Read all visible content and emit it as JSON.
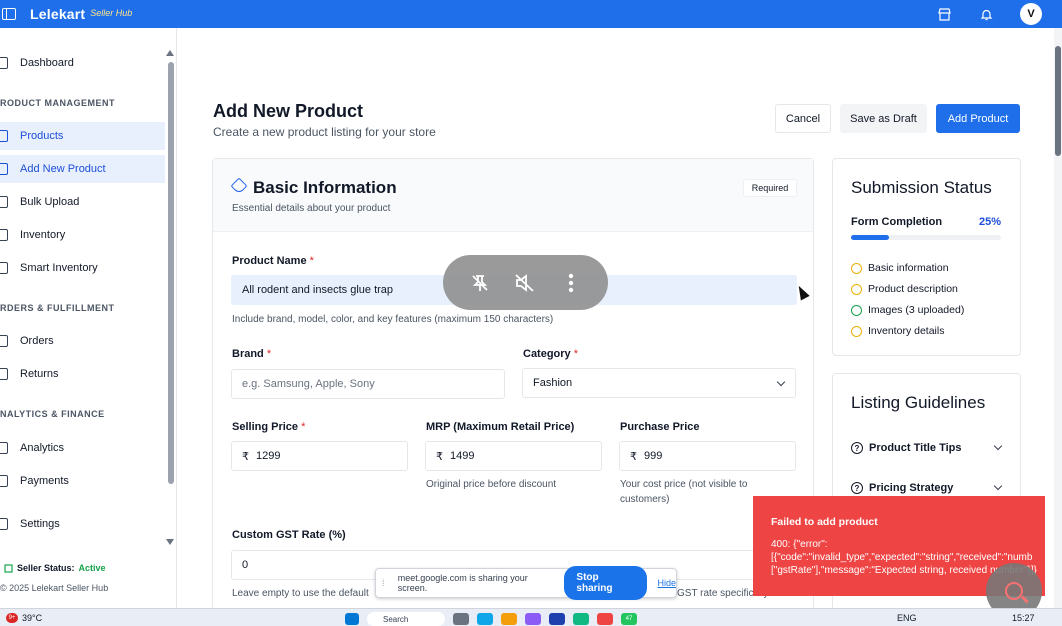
{
  "app": {
    "brand": "Lelekart",
    "brand_sub": "Seller Hub",
    "avatar_initial": "V"
  },
  "sidebar": {
    "items": [
      {
        "label": "Dashboard"
      },
      {
        "label": "Products"
      },
      {
        "label": "Add New Product"
      },
      {
        "label": "Bulk Upload"
      },
      {
        "label": "Inventory"
      },
      {
        "label": "Smart Inventory"
      },
      {
        "label": "Orders"
      },
      {
        "label": "Returns"
      },
      {
        "label": "Analytics"
      },
      {
        "label": "Payments"
      },
      {
        "label": "Settings"
      }
    ],
    "sections": [
      "RODUCT MANAGEMENT",
      "RDERS & FULFILLMENT",
      "NALYTICS & FINANCE"
    ],
    "status_label": "Seller Status:",
    "status_value": "Active",
    "copyright": "© 2025 Lelekart Seller Hub"
  },
  "header": {
    "title": "Add New Product",
    "subtitle": "Create a new product listing for your store",
    "cancel": "Cancel",
    "save_draft": "Save as Draft",
    "add_product": "Add Product"
  },
  "basic_info": {
    "title": "Basic Information",
    "subtitle": "Essential details about your product",
    "required_badge": "Required",
    "product_name_label": "Product Name",
    "product_name_value": "All rodent and insects glue trap",
    "product_name_help": "Include brand, model, color, and key features (maximum 150 characters)",
    "brand_label": "Brand",
    "brand_placeholder": "e.g. Samsung, Apple, Sony",
    "category_label": "Category",
    "category_value": "Fashion",
    "selling_price_label": "Selling Price",
    "selling_price_value": "1299",
    "mrp_label": "MRP (Maximum Retail Price)",
    "mrp_value": "1499",
    "mrp_help": "Original price before discount",
    "purchase_price_label": "Purchase Price",
    "purchase_price_value": "999",
    "purchase_price_help_1": "Your cost price (not visible to",
    "purchase_price_help_2": "customers)",
    "gst_label": "Custom GST Rate (%)",
    "gst_value": "0",
    "gst_help": "Leave empty to use the default",
    "gst_help_right": "GST rate specifically for",
    "currency_symbol": "₹",
    "star": "*"
  },
  "submission": {
    "title": "Submission Status",
    "completion_label": "Form Completion",
    "completion_value": "25%",
    "completion_fraction": 0.25,
    "checks": [
      {
        "label": "Basic information",
        "state": "pending"
      },
      {
        "label": "Product description",
        "state": "pending"
      },
      {
        "label": "Images (3 uploaded)",
        "state": "done"
      },
      {
        "label": "Inventory details",
        "state": "pending"
      }
    ]
  },
  "guidelines": {
    "title": "Listing Guidelines",
    "items": [
      {
        "label": "Product Title Tips"
      },
      {
        "label": "Pricing Strategy"
      }
    ]
  },
  "toast": {
    "title": "Failed to add product",
    "line1": "400: {\"error\":",
    "line2": "[{\"code\":\"invalid_type\",\"expected\":\"string\",\"received\":\"numb",
    "line3": "[\"gstRate\"],\"message\":\"Expected string, received number\"}]}"
  },
  "meet": {
    "message": "meet.google.com is sharing your screen.",
    "stop": "Stop sharing",
    "hide": "Hide"
  },
  "taskbar": {
    "weather_badge": "9+",
    "temperature": "39°C",
    "search": "Search",
    "lang": "ENG",
    "time": "15:27",
    "badge_47": "47"
  },
  "colors": {
    "brand": "#1f6feb",
    "error": "#ef4444",
    "success": "#16a34a",
    "warning": "#eab308"
  }
}
